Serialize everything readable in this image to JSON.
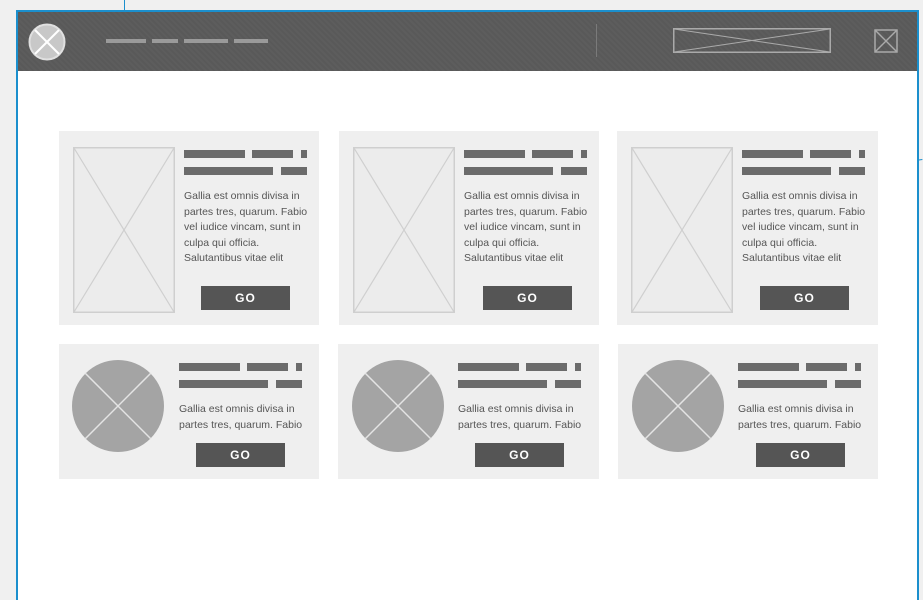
{
  "header": {
    "logo_icon": "placeholder-circle-x-icon",
    "search_icon": "placeholder-rect-x-icon",
    "close_icon": "close-box-x-icon"
  },
  "cards_top": [
    {
      "desc": "Gallia est omnis divisa in\npartes tres, quarum. Fabio\nvel iudice vincam, sunt in\nculpa qui officia.\nSalutantibus vitae elit",
      "button": "GO"
    },
    {
      "desc": "Gallia est omnis divisa in\npartes tres, quarum. Fabio\nvel iudice vincam, sunt in\nculpa qui officia.\nSalutantibus vitae elit",
      "button": "GO"
    },
    {
      "desc": "Gallia est omnis divisa in\npartes tres, quarum. Fabio\nvel iudice vincam, sunt in\nculpa qui officia.\nSalutantibus vitae elit",
      "button": "GO"
    }
  ],
  "cards_bottom": [
    {
      "desc": "Gallia est omnis divisa in\npartes tres, quarum. Fabio",
      "button": "GO"
    },
    {
      "desc": "Gallia est omnis divisa in\npartes tres, quarum. Fabio",
      "button": "GO"
    },
    {
      "desc": "Gallia est omnis divisa in\npartes tres, quarum. Fabio",
      "button": "GO"
    }
  ],
  "colors": {
    "annotation": "#1b8fcd",
    "topbar": "#595959",
    "card_bg": "#efefef",
    "button_bg": "#555555"
  }
}
